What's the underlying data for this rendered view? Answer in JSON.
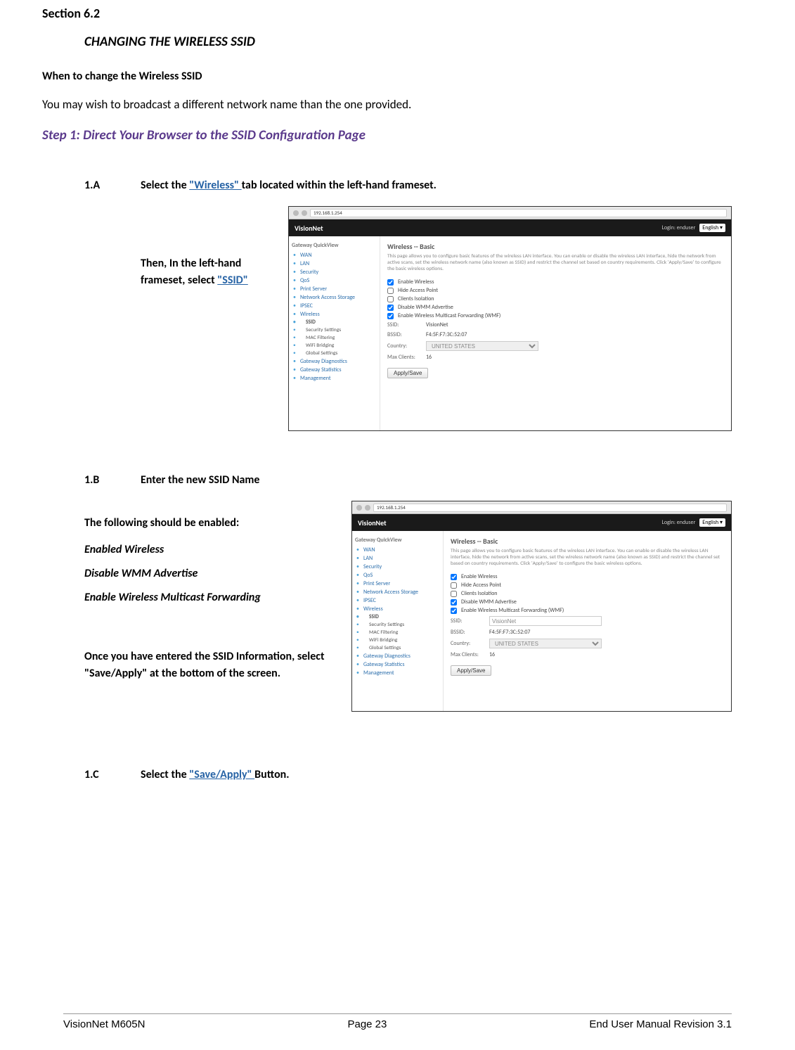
{
  "section_label": "Section 6.2",
  "section_heading": "CHANGING THE WIRELESS SSID",
  "subheading": "When to change the Wireless SSID",
  "intro_text": "You may wish to broadcast a different network name than the one provided.",
  "step1_heading": "Step 1: Direct Your Browser to the SSID Configuration Page",
  "step_1a": {
    "id": "1.A",
    "prefix": "Select the ",
    "link": "\"Wireless\" ",
    "suffix": "tab located within the left-hand frameset.",
    "side_prefix": "Then, In the left-hand frameset, select ",
    "side_link": "\"SSID\""
  },
  "step_1b": {
    "id": "1.B",
    "title": "Enter the new SSID Name",
    "p1": "The following should be enabled:",
    "i1": "Enabled Wireless",
    "i2": "Disable WMM Advertise",
    "i3": "Enable Wireless Multicast Forwarding",
    "p2a": "Once you have entered the SSID Information, select \"Save/Apply\" at the bottom of the screen."
  },
  "step_1c": {
    "id": "1.C",
    "prefix": "Select the ",
    "link": "\"Save/Apply\" ",
    "suffix": "Button."
  },
  "screenshot": {
    "address": "192.168.1.254",
    "brand": "VisionNet",
    "login_label": "Login: enduser",
    "lang": "English",
    "nav_header1": "Gateway QuickView",
    "nav_items1": [
      "WAN",
      "LAN",
      "Security",
      "QoS",
      "Print Server",
      "Network Access Storage",
      "IPSEC"
    ],
    "nav_wireless": "Wireless",
    "nav_ssid": "SSID",
    "nav_sub": [
      "Security Settings",
      "MAC Filtering",
      "WiFi Bridging",
      "Global Settings"
    ],
    "nav_items2": [
      "Gateway Diagnostics",
      "Gateway Statistics",
      "Management"
    ],
    "main_heading": "Wireless -- Basic",
    "main_desc": "This page allows you to configure basic features of the wireless LAN interface. You can enable or disable the wireless LAN interface, hide the network from active scans, set the wireless network name (also known as SSID) and restrict the channel set based on country requirements. Click 'Apply/Save' to configure the basic wireless options.",
    "cb1": "Enable Wireless",
    "cb2": "Hide Access Point",
    "cb3": "Clients Isolation",
    "cb4": "Disable WMM Advertise",
    "cb5": "Enable Wireless Multicast Forwarding (WMF)",
    "ssid_label": "SSID:",
    "ssid_value": "VisionNet",
    "bssid_label": "BSSID:",
    "bssid_value": "F4:5F:F7:3C:52:07",
    "country_label": "Country:",
    "country_value": "UNITED STATES",
    "max_label": "Max Clients:",
    "max_value": "16",
    "apply_btn": "Apply/Save"
  },
  "footer": {
    "left": "VisionNet M605N",
    "center": "Page 23",
    "right": "End User Manual Revision 3.1"
  }
}
